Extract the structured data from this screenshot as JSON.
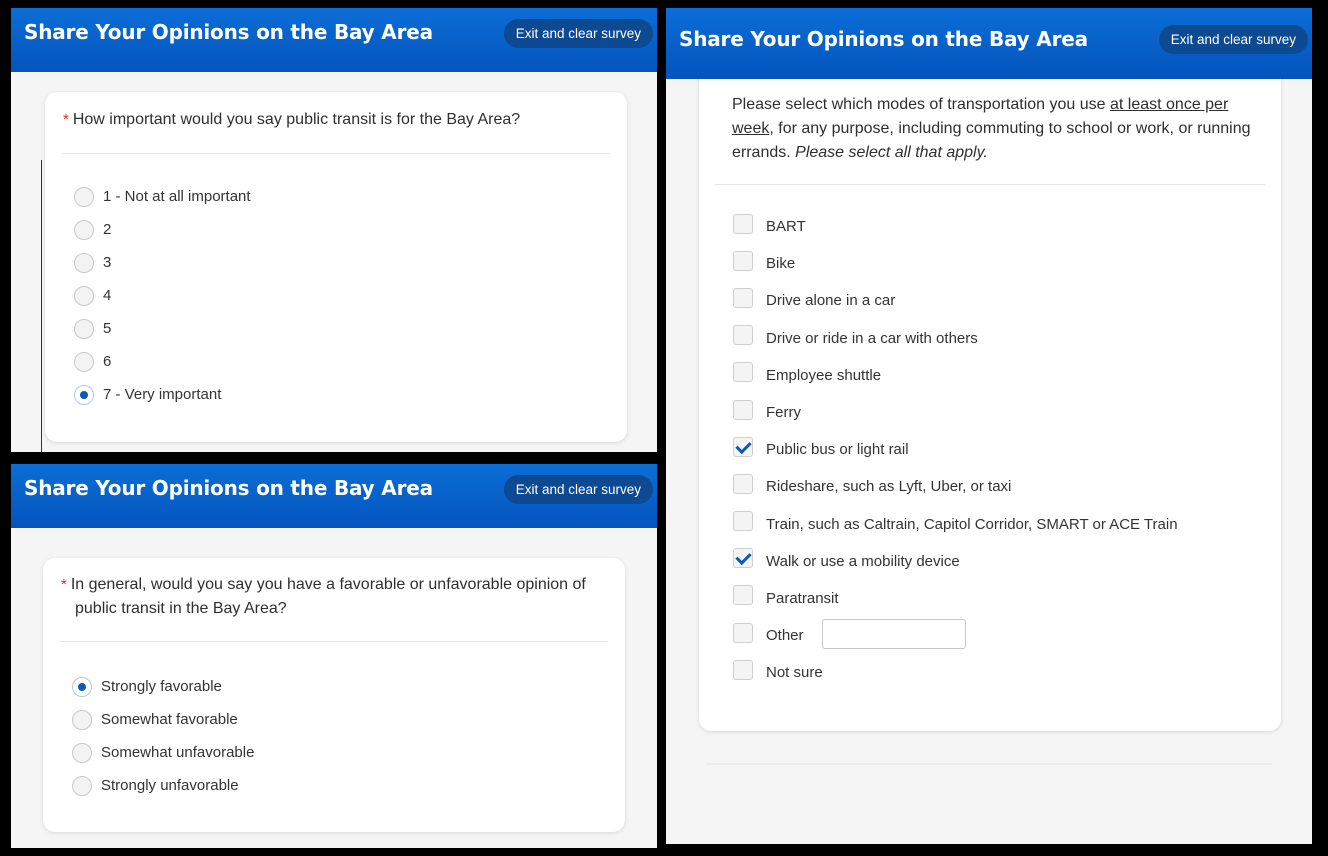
{
  "app": {
    "title": "Share Your Opinions on the Bay Area",
    "exit_label": "Exit and clear survey"
  },
  "q1": {
    "required_mark": "*",
    "text": "How important would you say public transit is for the Bay Area?",
    "options": [
      "1 - Not at all important",
      "2",
      "3",
      "4",
      "5",
      "6",
      "7 - Very important"
    ],
    "selected": "7 - Very important"
  },
  "q2": {
    "required_mark": "*",
    "text": "In general, would you say you have a favorable or unfavorable opinion of public transit in the Bay Area?",
    "options": [
      "Strongly favorable",
      "Somewhat favorable",
      "Somewhat unfavorable",
      "Strongly unfavorable"
    ],
    "selected": "Strongly favorable"
  },
  "q3": {
    "text_part1": "Please select which modes of transportation you use ",
    "text_underlined": "at least once per week",
    "text_part2": ", for any purpose, including commuting to school or work, or running errands. ",
    "text_italic": "Please select all that apply.",
    "options": [
      "BART",
      "Bike",
      "Drive alone in a car",
      "Drive or ride in a car with others",
      "Employee shuttle",
      "Ferry",
      "Public bus or light rail",
      "Rideshare, such as Lyft, Uber, or taxi",
      "Train, such as Caltrain, Capitol Corridor, SMART or ACE Train",
      "Walk or use a mobility device",
      "Paratransit",
      "Other",
      "Not sure"
    ],
    "checked": [
      "Public bus or light rail",
      "Walk or use a mobility device"
    ],
    "other_value": ""
  },
  "colors": {
    "header": "#0b6ed6",
    "accent": "#0a5bb5",
    "required": "#d93025"
  }
}
